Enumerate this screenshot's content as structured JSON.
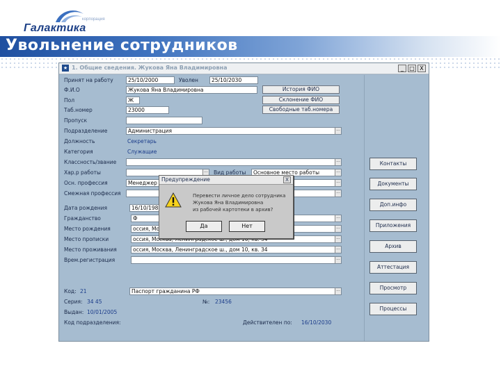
{
  "header": {
    "logo_corp": "корпорация",
    "logo_name": "Галактика",
    "slide_title": "Увольнение сотрудников"
  },
  "window": {
    "title": "1. Общие сведения. Жукова Яна Владимировна",
    "min": "_",
    "max": "□",
    "close": "X"
  },
  "form": {
    "hire_label": "Принят на работу",
    "hire_date": "25/10/2000",
    "fired_label": "Уволен",
    "fired_date": "25/10/2030",
    "fio_label": "Ф.И.О",
    "fio_value": "Жукова Яна Владимировна",
    "history_btn": "История ФИО",
    "sex_label": "Пол",
    "sex_value": "Ж",
    "decline_btn": "Склонение ФИО",
    "tabno_label": "Таб.номер",
    "tabno_value": "23000",
    "free_tabno_btn": "Свободные таб.номера",
    "pass_label": "Пропуск",
    "dept_label": "Подразделение",
    "dept_value": "Администрация",
    "position_label": "Должность",
    "position_value": "Секретарь",
    "category_label": "Категория",
    "category_value": "Служащие",
    "class_label": "Классность/звание",
    "character_label": "Хар.р работы",
    "worktype_label": "Вид работы",
    "worktype_value": "Основное место работы",
    "profession_label": "Осн. профессия",
    "profession_value": "Менеджер",
    "alt_profession_label": "Смежная профессия",
    "birthdate_label": "Дата рождения",
    "birthdate_value": "16/10/1985",
    "citizenship_label": "Гражданство",
    "citizenship_value": "Ф",
    "birthplace_label": "Место рождения",
    "birthplace_value": "оссия, Москва",
    "registration_label": "Место прописки",
    "registration_value": "оссия, Москва, Ленинградское ш., дом 10, кв. 34",
    "residence_label": "Место проживания",
    "residence_value": "оссия, Москва, Ленинградское ш., дом 10, кв. 34",
    "temp_reg_label": "Врем.регистрация",
    "doc_code_label": "Код:",
    "doc_code_value": "21",
    "doc_type_value": "Паспорт гражданина РФ",
    "series_label": "Серия:",
    "series_value": "34 45",
    "number_label": "№:",
    "number_value": "23456",
    "issued_label": "Выдан:",
    "issued_value": "10/01/2005",
    "subdivision_label": "Код подразделения:",
    "valid_label": "Действителен по:",
    "valid_value": "16/10/2030"
  },
  "side_buttons": [
    "Контакты",
    "Документы",
    "Доп.инфо",
    "Приложения",
    "Архив",
    "Аттестация",
    "Просмотр",
    "Процессы"
  ],
  "dialog": {
    "title": "Предупреждение",
    "close": "X",
    "line1": "Перевести личное дело сотрудника",
    "line2": "Жукова Яна Владимировна",
    "line3": "из рабочей картотеки в архив?",
    "yes": "Да",
    "no": "Нет"
  },
  "colors": {
    "brand_blue": "#1c3f86",
    "window_bg": "#a6bcd0"
  }
}
